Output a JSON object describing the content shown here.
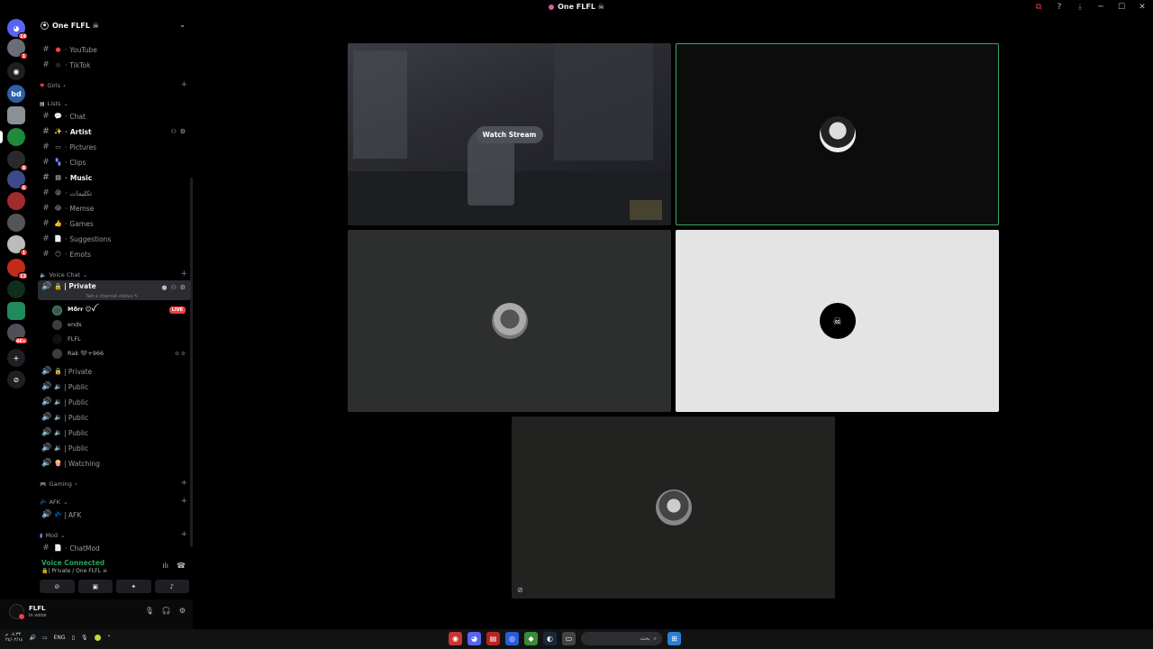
{
  "window": {
    "title": "One FLFL ☠︎",
    "controls": [
      "─",
      "☐",
      "✕"
    ]
  },
  "servers": [
    {
      "name": "discord-home",
      "label": "",
      "badge": "14"
    },
    {
      "name": "server-1",
      "label": "",
      "badge": "1"
    },
    {
      "name": "server-2",
      "label": "◉",
      "badge": ""
    },
    {
      "name": "server-bd",
      "label": "bd",
      "badge": ""
    },
    {
      "name": "server-4",
      "label": "",
      "badge": ""
    },
    {
      "name": "server-5",
      "label": "",
      "badge": ""
    },
    {
      "name": "server-6",
      "label": "",
      "badge": "8"
    },
    {
      "name": "server-7",
      "label": "",
      "badge": "6"
    },
    {
      "name": "server-8",
      "label": "",
      "badge": ""
    },
    {
      "name": "server-9",
      "label": "",
      "badge": ""
    },
    {
      "name": "server-10",
      "label": "",
      "badge": "1"
    },
    {
      "name": "server-11",
      "label": "",
      "badge": "13"
    },
    {
      "name": "server-12",
      "label": "",
      "badge": ""
    },
    {
      "name": "server-13",
      "label": "",
      "badge": ""
    },
    {
      "name": "server-14",
      "label": "",
      "badge": "46+"
    }
  ],
  "guild": {
    "name": "One FLFL ☠︎"
  },
  "channels": {
    "youtube": "YouTube",
    "tiktok": "TikTok",
    "cat_girls": "Girls",
    "cat_lists": "Lists",
    "chat": "Chat",
    "artist": "Artist",
    "pictures": "Pictures",
    "clips": "Clips",
    "music": "Music",
    "arabic": "تكليمات",
    "memse": "Memse",
    "games": "Games",
    "suggestions": "Suggestions",
    "emots": "Emots",
    "cat_voice": "Voice Chat",
    "private1": "| Private",
    "channel_status": "Set a channel status",
    "live": "LIVE",
    "private2": "| Private",
    "public": "| Public",
    "watching": "| Watching",
    "cat_gaming": "Gaming",
    "cat_afk": "AFK",
    "afk": "| AFK",
    "cat_mod": "Mod",
    "chatmod": "ChatMod"
  },
  "voice_users": [
    {
      "name": "Mðrr ☺︎ꪜ",
      "bold": true
    },
    {
      "name": "ends",
      "bold": false
    },
    {
      "name": "FLFL",
      "bold": false
    },
    {
      "name": "Rak 🖤+966",
      "bold": false
    }
  ],
  "voice_panel": {
    "status": "Voice Connected",
    "location": "| Private / One FLFL ☠︎"
  },
  "user": {
    "name": "FLFL",
    "status": "In voice"
  },
  "stage": {
    "watch_label": "Watch Stream"
  },
  "taskbar": {
    "lang": "ENG",
    "search": "بحث",
    "clock": "٠٤:٣٣ م\n٢٤/٠٢/١٤"
  }
}
